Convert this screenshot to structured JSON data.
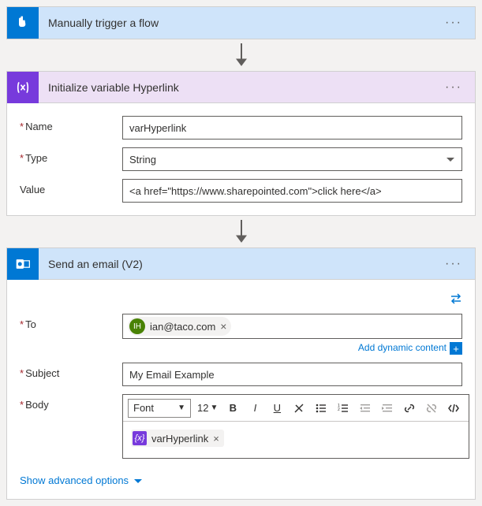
{
  "trigger": {
    "title": "Manually trigger a flow"
  },
  "variable": {
    "title": "Initialize variable Hyperlink",
    "name_label": "Name",
    "type_label": "Type",
    "value_label": "Value",
    "name_value": "varHyperlink",
    "type_value": "String",
    "value_value": "<a href=\"https://www.sharepointed.com\">click here</a>"
  },
  "email": {
    "title": "Send an email (V2)",
    "to_label": "To",
    "subject_label": "Subject",
    "body_label": "Body",
    "to_initials": "IH",
    "to_value": "ian@taco.com",
    "subject_value": "My Email Example",
    "dynamic_content": "Add dynamic content",
    "toolbar": {
      "font": "Font",
      "size": "12"
    },
    "body_token": "varHyperlink",
    "advanced": "Show advanced options"
  }
}
